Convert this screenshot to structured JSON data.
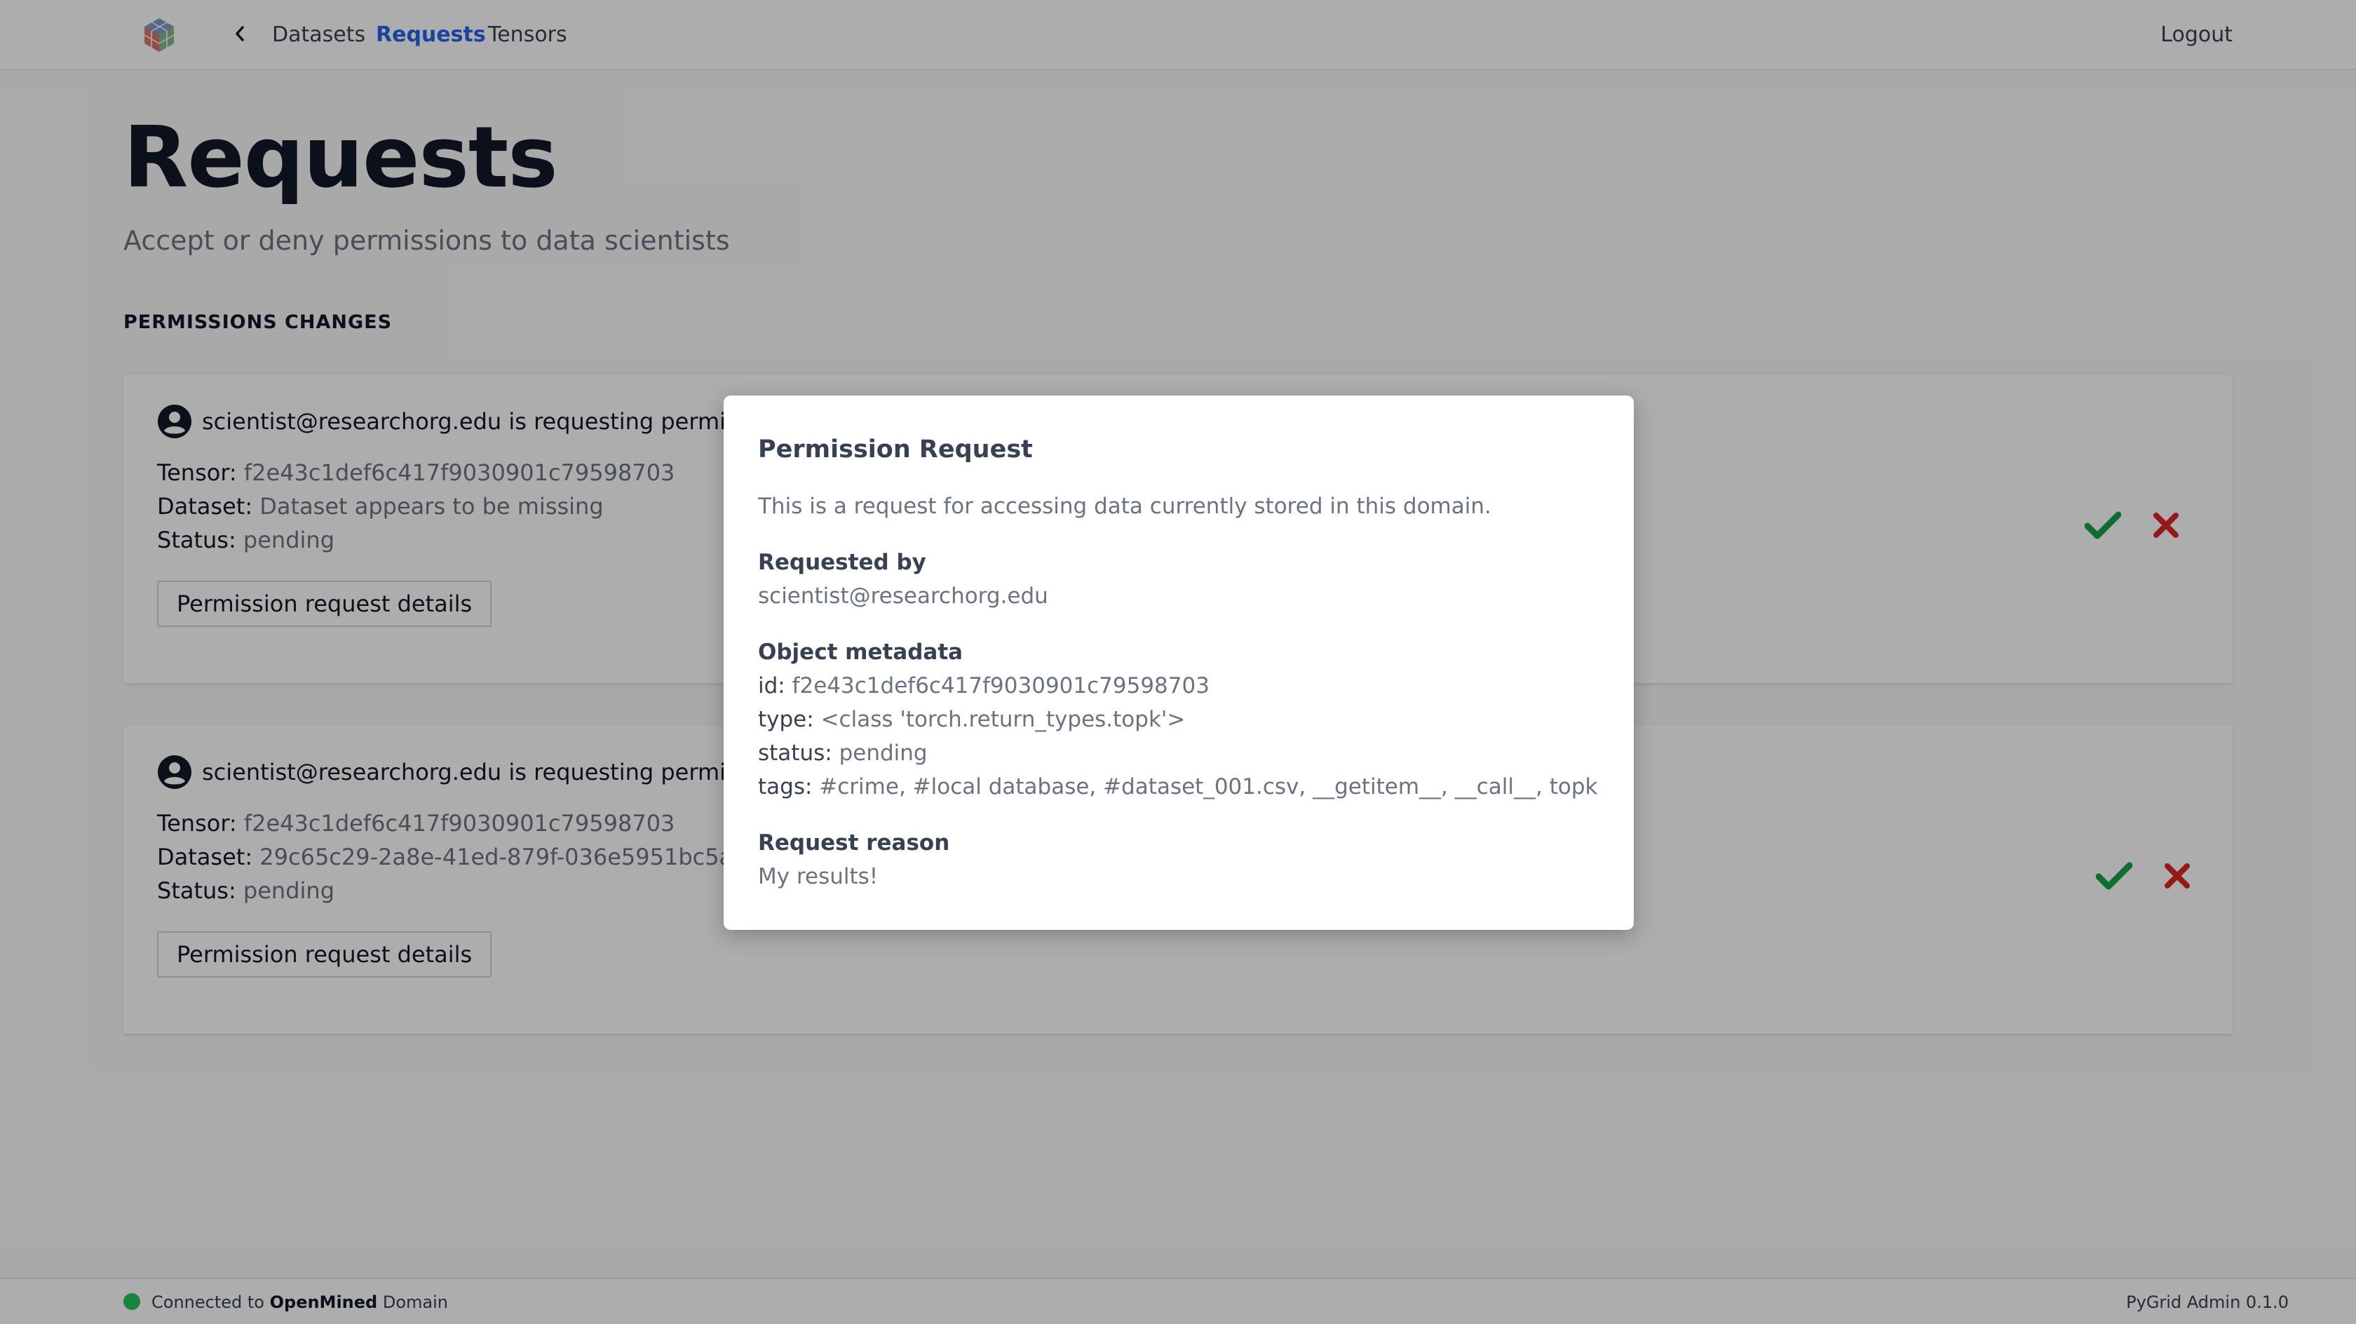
{
  "nav": {
    "items": [
      "Datasets",
      "Requests",
      "Tensors"
    ],
    "active": "Requests",
    "logout": "Logout"
  },
  "header": {
    "title": "Requests",
    "subtitle": "Accept or deny permissions to data scientists",
    "section_label": "PERMISSIONS CHANGES"
  },
  "labels": {
    "tensor": "Tensor:",
    "dataset": "Dataset:",
    "status": "Status:",
    "details_button": "Permission request details"
  },
  "requests": [
    {
      "requester_text": "scientist@researchorg.edu is requesting permission",
      "tensor": "f2e43c1def6c417f9030901c79598703",
      "dataset": "Dataset appears to be missing",
      "status": "pending"
    },
    {
      "requester_text": "scientist@researchorg.edu is requesting permission",
      "tensor": "f2e43c1def6c417f9030901c79598703",
      "dataset": "29c65c29-2a8e-41ed-879f-036e5951bc5a",
      "status": "pending"
    }
  ],
  "modal": {
    "title": "Permission Request",
    "description": "This is a request for accessing data currently stored in this domain.",
    "requested_by_label": "Requested by",
    "requested_by": "scientist@researchorg.edu",
    "metadata_label": "Object metadata",
    "id_label": "id:",
    "id": "f2e43c1def6c417f9030901c79598703",
    "type_label": "type:",
    "type": "<class 'torch.return_types.topk'>",
    "status_label": "status:",
    "status": "pending",
    "tags_label": "tags:",
    "tags": "#crime, #local database, #dataset_001.csv, __getitem__, __call__, topk",
    "reason_label": "Request reason",
    "reason": "My results!"
  },
  "footer": {
    "connected_prefix": "Connected to",
    "domain_name": "OpenMined",
    "connected_suffix": "Domain",
    "version": "PyGrid Admin 0.1.0"
  },
  "colors": {
    "accent": "#2563eb",
    "accept": "#16a34a",
    "deny": "#dc2626",
    "online": "#22c55e"
  },
  "icons": [
    "logo-icon",
    "chevron-left-icon",
    "user-circle-icon",
    "check-icon",
    "x-icon"
  ]
}
